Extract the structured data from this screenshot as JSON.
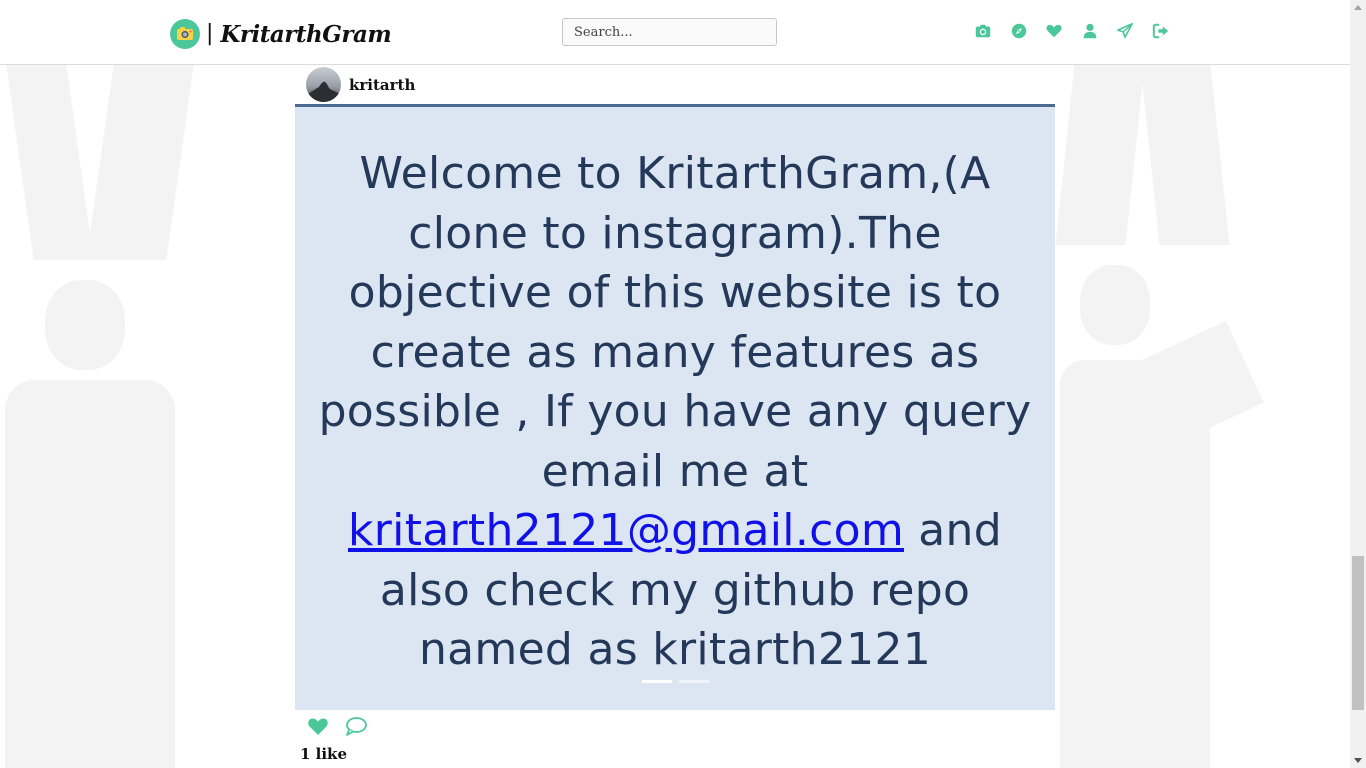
{
  "colors": {
    "accent": "#4cc79a",
    "post_bg": "#dce6f2",
    "post_text": "#24385a",
    "link": "#1010e8",
    "header_rule": "#4a6a92"
  },
  "header": {
    "brand_separator": "|",
    "brand_name": "KritarthGram",
    "search_placeholder": "Search...",
    "nav_icons": [
      "camera-icon",
      "compass-icon",
      "heart-icon",
      "user-icon",
      "paper-plane-icon",
      "sign-out-icon"
    ]
  },
  "post": {
    "username": "kritarth",
    "image_text": {
      "before": "Welcome to KritarthGram,(A clone to instagram).The objective of  this website is to create as many features as possible , If you have any query email me at ",
      "email": "kritarth2121@gmail.com",
      "after": " and also check my github repo named as kritarth2121"
    },
    "carousel": {
      "count": 2,
      "active": 1
    },
    "likes": "1 like"
  }
}
